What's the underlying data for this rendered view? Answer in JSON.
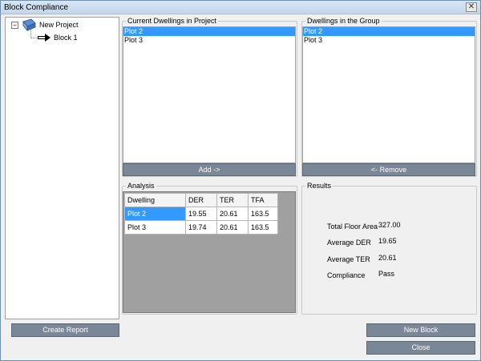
{
  "window": {
    "title": "Block Compliance",
    "close_glyph": "✕"
  },
  "tree": {
    "toggle_glyph": "⊟",
    "project_label": "New Project",
    "block_label": "Block 1"
  },
  "current_dwellings": {
    "title": "Current Dwellings in Project",
    "items": [
      "Plot 2",
      "Plot 3"
    ],
    "selected": "Plot 2",
    "add_button": "Add ->"
  },
  "group_dwellings": {
    "title": "Dwellings in the Group",
    "items": [
      "Plot 2",
      "Plot 3"
    ],
    "selected": "Plot 2",
    "remove_button": "<- Remove"
  },
  "analysis": {
    "title": "Analysis",
    "columns": [
      "Dwelling",
      "DER",
      "TER",
      "TFA"
    ],
    "rows": [
      [
        "Plot 2",
        "19.55",
        "20.61",
        "163.5"
      ],
      [
        "Plot 3",
        "19.74",
        "20.61",
        "163.5"
      ]
    ]
  },
  "results": {
    "title": "Results",
    "total_floor_area_label": "Total Floor Area",
    "total_floor_area_value": "327.00",
    "average_der_label": "Average DER",
    "average_der_value": "19.65",
    "average_ter_label": "Average TER",
    "average_ter_value": "20.61",
    "compliance_label": "Compliance",
    "compliance_value": "Pass"
  },
  "buttons": {
    "create_report": "Create Report",
    "new_block": "New Block",
    "close": "Close"
  },
  "colors": {
    "selection": "#3399ff",
    "button_bg": "#7a8796",
    "grid_bg": "#a0a0a0"
  }
}
